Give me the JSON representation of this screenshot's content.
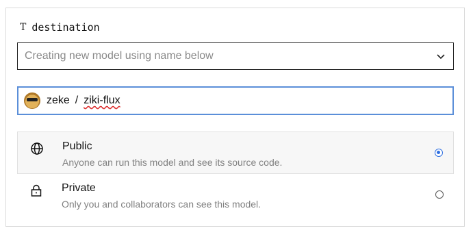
{
  "destination": {
    "label": "destination",
    "type_icon": "T",
    "select": {
      "placeholder": "Creating new model using name below"
    },
    "model_name": {
      "owner": "zeke",
      "separator": "/",
      "name": "ziki-flux"
    }
  },
  "visibility": {
    "options": [
      {
        "title": "Public",
        "description": "Anyone can run this model and see its source code.",
        "icon": "globe-icon",
        "selected": true
      },
      {
        "title": "Private",
        "description": "Only you and collaborators can see this model.",
        "icon": "lock-icon",
        "selected": false
      }
    ]
  },
  "colors": {
    "accent": "#2f6fe0",
    "focus_border": "#5b8fd9",
    "muted_text": "#808080"
  }
}
